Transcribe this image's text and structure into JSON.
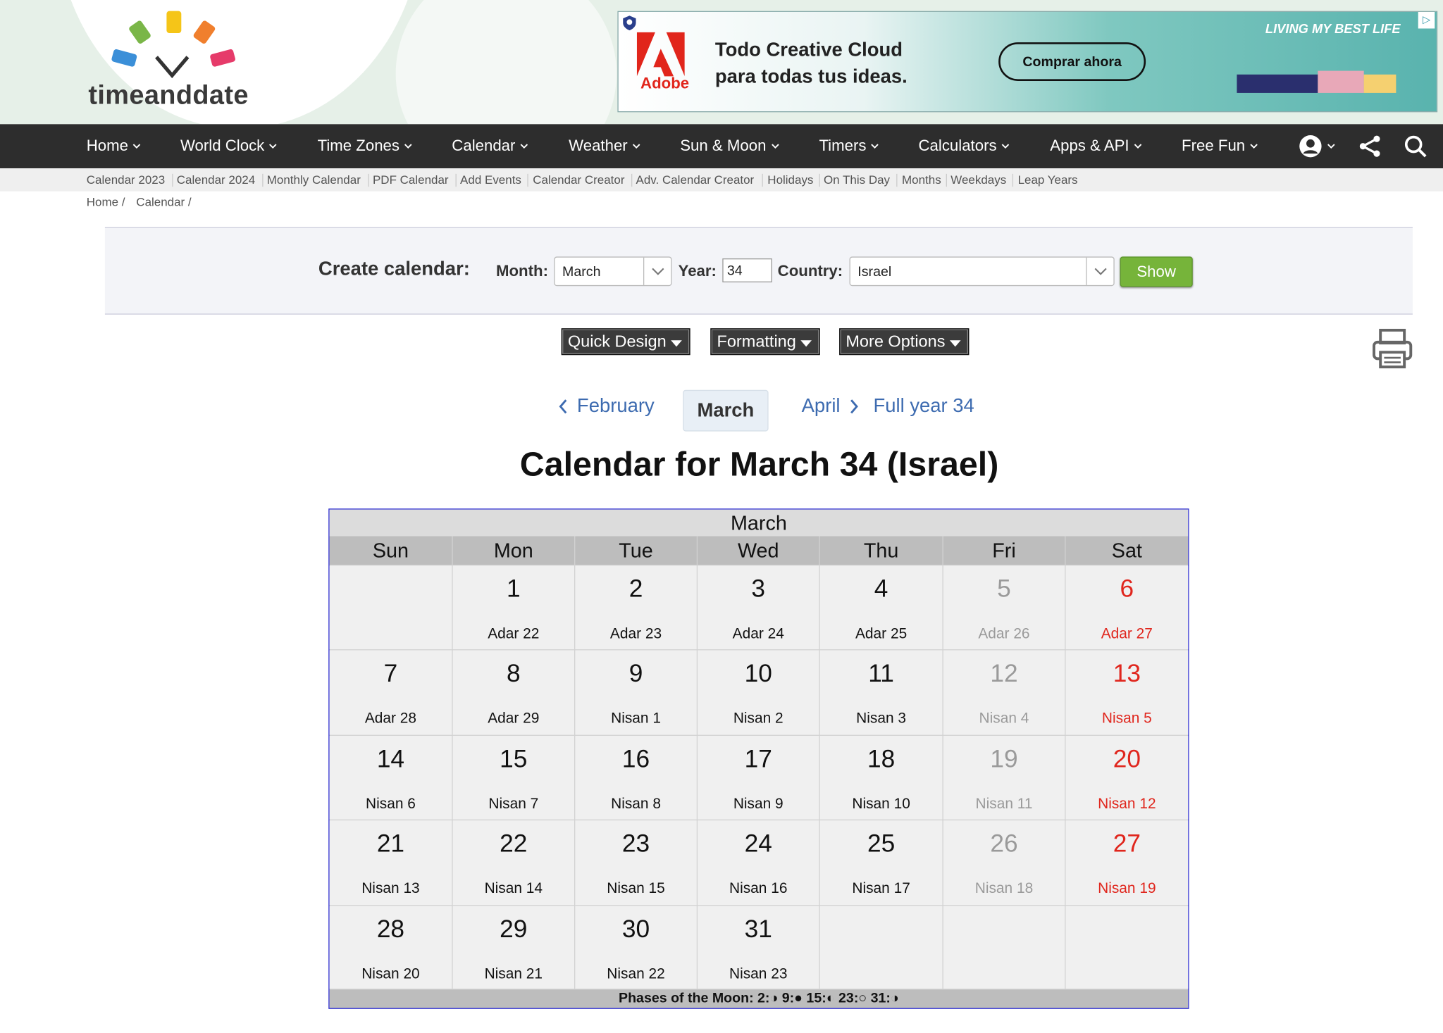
{
  "logo": {
    "text": "timeanddate"
  },
  "ad": {
    "brand": "Adobe",
    "line1": "Todo Creative Cloud",
    "line2": "para todas tus ideas.",
    "cta": "Comprar ahora",
    "badge": "LIVING MY BEST LIFE",
    "colors": {
      "adobe_red": "#e1251b"
    }
  },
  "nav": {
    "items": [
      {
        "label": "Home"
      },
      {
        "label": "World Clock"
      },
      {
        "label": "Time Zones"
      },
      {
        "label": "Calendar"
      },
      {
        "label": "Weather"
      },
      {
        "label": "Sun & Moon"
      },
      {
        "label": "Timers"
      },
      {
        "label": "Calculators"
      },
      {
        "label": "Apps & API"
      },
      {
        "label": "Free Fun"
      }
    ],
    "icons": [
      "account-icon",
      "share-icon",
      "search-icon"
    ]
  },
  "subnav": {
    "items": [
      {
        "label": "Calendar 2023"
      },
      {
        "label": "Calendar 2024"
      },
      {
        "label": "Monthly Calendar"
      },
      {
        "label": "PDF Calendar"
      },
      {
        "label": "Add Events"
      },
      {
        "label": "Calendar Creator"
      },
      {
        "label": "Adv. Calendar Creator"
      },
      {
        "label": "Holidays"
      },
      {
        "label": "On This Day"
      },
      {
        "label": "Months"
      },
      {
        "label": "Weekdays"
      },
      {
        "label": "Leap Years"
      }
    ]
  },
  "breadcrumb": {
    "home": "Home /",
    "calendar": "Calendar /"
  },
  "form": {
    "heading": "Create calendar:",
    "month_label": "Month:",
    "month_value": "March",
    "year_label": "Year:",
    "year_value": "34",
    "country_label": "Country:",
    "country_value": "Israel",
    "show_label": "Show",
    "show_color": "#76b43a"
  },
  "options": {
    "quick_design": "Quick Design",
    "formatting": "Formatting",
    "more_options": "More Options"
  },
  "month_nav": {
    "prev": "February",
    "current": "March",
    "next": "April",
    "full_year": "Full year 34"
  },
  "page_title": "Calendar for March 34 (Israel)",
  "calendar": {
    "month": "March",
    "weekdays": [
      "Sun",
      "Mon",
      "Tue",
      "Wed",
      "Thu",
      "Fri",
      "Sat"
    ],
    "colors": {
      "weekend_fri": "#9a9a9a",
      "weekend_sat": "#e0261d",
      "border": "#2b2bd6"
    },
    "weeks": [
      [
        null,
        {
          "day": "1",
          "heb": "Adar 22"
        },
        {
          "day": "2",
          "heb": "Adar 23"
        },
        {
          "day": "3",
          "heb": "Adar 24"
        },
        {
          "day": "4",
          "heb": "Adar 25"
        },
        {
          "day": "5",
          "heb": "Adar 26"
        },
        {
          "day": "6",
          "heb": "Adar 27"
        }
      ],
      [
        {
          "day": "7",
          "heb": "Adar 28"
        },
        {
          "day": "8",
          "heb": "Adar 29"
        },
        {
          "day": "9",
          "heb": "Nisan 1"
        },
        {
          "day": "10",
          "heb": "Nisan 2"
        },
        {
          "day": "11",
          "heb": "Nisan 3"
        },
        {
          "day": "12",
          "heb": "Nisan 4"
        },
        {
          "day": "13",
          "heb": "Nisan 5"
        }
      ],
      [
        {
          "day": "14",
          "heb": "Nisan 6"
        },
        {
          "day": "15",
          "heb": "Nisan 7"
        },
        {
          "day": "16",
          "heb": "Nisan 8"
        },
        {
          "day": "17",
          "heb": "Nisan 9"
        },
        {
          "day": "18",
          "heb": "Nisan 10"
        },
        {
          "day": "19",
          "heb": "Nisan 11"
        },
        {
          "day": "20",
          "heb": "Nisan 12"
        }
      ],
      [
        {
          "day": "21",
          "heb": "Nisan 13"
        },
        {
          "day": "22",
          "heb": "Nisan 14"
        },
        {
          "day": "23",
          "heb": "Nisan 15"
        },
        {
          "day": "24",
          "heb": "Nisan 16"
        },
        {
          "day": "25",
          "heb": "Nisan 17"
        },
        {
          "day": "26",
          "heb": "Nisan 18"
        },
        {
          "day": "27",
          "heb": "Nisan 19"
        }
      ],
      [
        {
          "day": "28",
          "heb": "Nisan 20"
        },
        {
          "day": "29",
          "heb": "Nisan 21"
        },
        {
          "day": "30",
          "heb": "Nisan 22"
        },
        {
          "day": "31",
          "heb": "Nisan 23"
        },
        null,
        null,
        null
      ]
    ],
    "moon_phases": "Phases of the Moon: 2:◑ 9:● 15:◐ 23:○ 31:◑"
  }
}
